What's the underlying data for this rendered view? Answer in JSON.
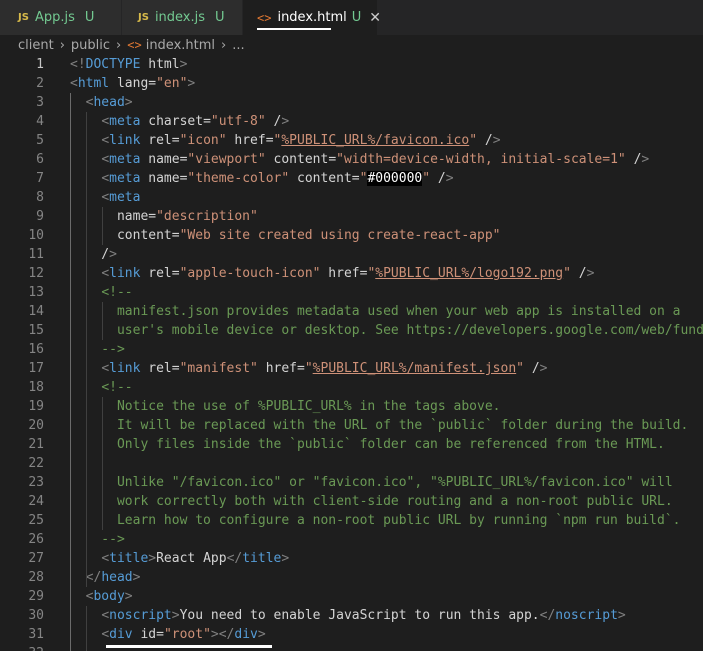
{
  "tabs": [
    {
      "icon": "JS",
      "label": "App.js",
      "status": "U"
    },
    {
      "icon": "JS",
      "label": "index.js",
      "status": "U"
    },
    {
      "icon": "<>",
      "label": "index.html",
      "status": "U",
      "close": "✕"
    }
  ],
  "breadcrumb": {
    "parts": [
      "client",
      "public",
      "index.html",
      "..."
    ]
  },
  "lines": [
    {
      "n": "1",
      "text": "<!DOCTYPE html>"
    },
    {
      "n": "2",
      "text": "<html lang=\"en\">"
    },
    {
      "n": "3",
      "text": "  <head>"
    },
    {
      "n": "4",
      "text": "    <meta charset=\"utf-8\" />"
    },
    {
      "n": "5",
      "text": "    <link rel=\"icon\" href=\"%PUBLIC_URL%/favicon.ico\" />"
    },
    {
      "n": "6",
      "text": "    <meta name=\"viewport\" content=\"width=device-width, initial-scale=1\" />"
    },
    {
      "n": "7",
      "text": "    <meta name=\"theme-color\" content=\"#000000\" />"
    },
    {
      "n": "8",
      "text": "    <meta"
    },
    {
      "n": "9",
      "text": "      name=\"description\""
    },
    {
      "n": "10",
      "text": "      content=\"Web site created using create-react-app\""
    },
    {
      "n": "11",
      "text": "    />"
    },
    {
      "n": "12",
      "text": "    <link rel=\"apple-touch-icon\" href=\"%PUBLIC_URL%/logo192.png\" />"
    },
    {
      "n": "13",
      "text": "    <!--"
    },
    {
      "n": "14",
      "text": "      manifest.json provides metadata used when your web app is installed on a"
    },
    {
      "n": "15",
      "text": "      user's mobile device or desktop. See https://developers.google.com/web/fundamentals/web-app-manifest/"
    },
    {
      "n": "16",
      "text": "    -->"
    },
    {
      "n": "17",
      "text": "    <link rel=\"manifest\" href=\"%PUBLIC_URL%/manifest.json\" />"
    },
    {
      "n": "18",
      "text": "    <!--"
    },
    {
      "n": "19",
      "text": "      Notice the use of %PUBLIC_URL% in the tags above."
    },
    {
      "n": "20",
      "text": "      It will be replaced with the URL of the `public` folder during the build."
    },
    {
      "n": "21",
      "text": "      Only files inside the `public` folder can be referenced from the HTML."
    },
    {
      "n": "22",
      "text": ""
    },
    {
      "n": "23",
      "text": "      Unlike \"/favicon.ico\" or \"favicon.ico\", \"%PUBLIC_URL%/favicon.ico\" will"
    },
    {
      "n": "24",
      "text": "      work correctly both with client-side routing and a non-root public URL."
    },
    {
      "n": "25",
      "text": "      Learn how to configure a non-root public URL by running `npm run build`."
    },
    {
      "n": "26",
      "text": "    -->"
    },
    {
      "n": "27",
      "text": "    <title>React App</title>"
    },
    {
      "n": "28",
      "text": "  </head>"
    },
    {
      "n": "29",
      "text": "  <body>"
    },
    {
      "n": "30",
      "text": "    <noscript>You need to enable JavaScript to run this app.</noscript>"
    },
    {
      "n": "31",
      "text": "    <div id=\"root\"></div>"
    },
    {
      "n": "32",
      "text": ""
    }
  ],
  "colors": {
    "tag": "#569cd6",
    "attr": "#9cdcfe",
    "value": "#ce9178",
    "comment": "#6a9955",
    "bracket": "#808080",
    "background": "#1e1e1e"
  }
}
